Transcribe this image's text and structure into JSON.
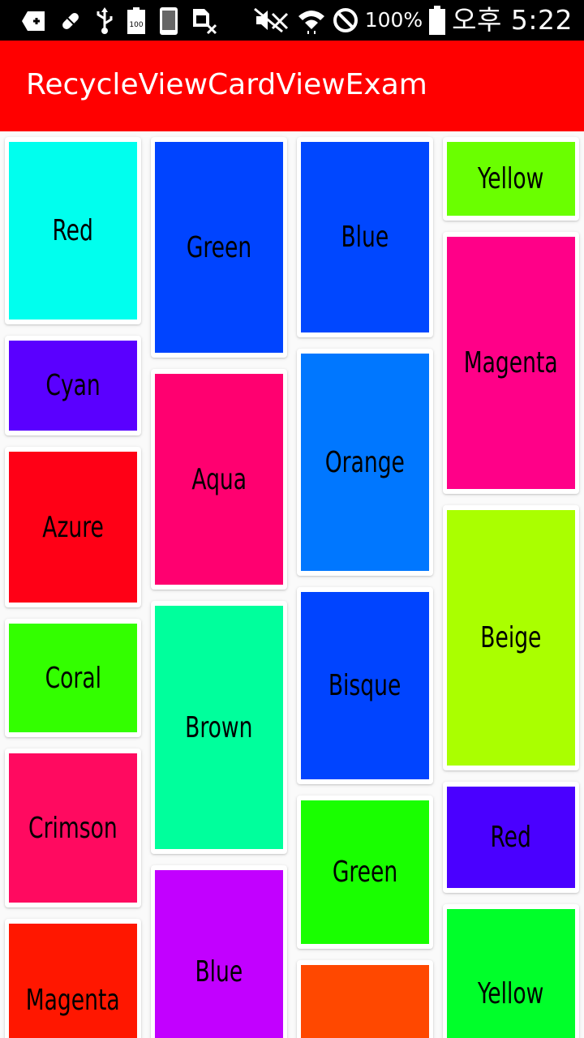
{
  "status_bar": {
    "battery_percent": "100%",
    "time": "오후 5:22",
    "icons": [
      "notification-plus-icon",
      "pill-icon",
      "usb-icon",
      "battery-saver-icon",
      "phone-screen-icon",
      "sim-x-icon",
      "mute-icon",
      "wifi-icon",
      "block-icon",
      "battery-icon"
    ],
    "battery_badge": "100"
  },
  "app_bar": {
    "title": "RecycleViewCardViewExam",
    "background": "#ff0000"
  },
  "cards": [
    {
      "label": "Red",
      "color": "#00ffee"
    },
    {
      "label": "Cyan",
      "color": "#5a00ff"
    },
    {
      "label": "Azure",
      "color": "#ff0016"
    },
    {
      "label": "Coral",
      "color": "#33ff00"
    },
    {
      "label": "Crimson",
      "color": "#ff0a60"
    },
    {
      "label": "Magenta",
      "color": "#ff1700"
    },
    {
      "label": "Green",
      "color": "#0044ff"
    },
    {
      "label": "Aqua",
      "color": "#ff0070"
    },
    {
      "label": "Brown",
      "color": "#00ff9c"
    },
    {
      "label": "Blue",
      "color": "#c200ff"
    },
    {
      "label": "Blue",
      "color": "#0047ff"
    },
    {
      "label": "Orange",
      "color": "#0077ff"
    },
    {
      "label": "Bisque",
      "color": "#0044ff"
    },
    {
      "label": "Green",
      "color": "#19ff00"
    },
    {
      "label": "",
      "color": "#ff4800"
    },
    {
      "label": "Yellow",
      "color": "#6aff00"
    },
    {
      "label": "Magenta",
      "color": "#ff0088"
    },
    {
      "label": "Beige",
      "color": "#aaff00"
    },
    {
      "label": "Red",
      "color": "#4a00ff"
    },
    {
      "label": "Yellow",
      "color": "#00ff2a"
    }
  ]
}
